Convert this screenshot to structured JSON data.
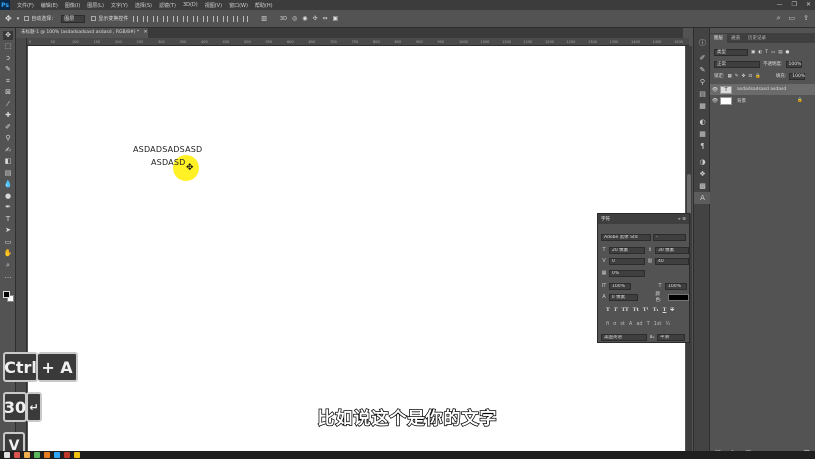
{
  "menubar": {
    "logo": "Ps",
    "items": [
      "文件(F)",
      "编辑(E)",
      "图像(I)",
      "图层(L)",
      "文字(Y)",
      "选择(S)",
      "滤镜(T)",
      "3D(D)",
      "视图(V)",
      "窗口(W)",
      "帮助(H)"
    ],
    "window_controls": [
      "—",
      "❐",
      "✕"
    ]
  },
  "options": {
    "auto_select_label": "自动选择：",
    "auto_select_value": "图层",
    "show_transform_label": "显示变换控件",
    "right_icons": [
      "⌕",
      "▭",
      "⇪"
    ]
  },
  "document": {
    "tab_title": "未标题-1 @ 100% (asdadsadsasd asdasd , RGB/8#) *",
    "ruler_ticks": [
      "0",
      "50",
      "100",
      "150",
      "200",
      "250",
      "300",
      "350",
      "400",
      "450",
      "500",
      "550",
      "600",
      "650",
      "700",
      "750",
      "800",
      "850",
      "900",
      "950",
      "1000",
      "1050",
      "1100",
      "1150",
      "1200",
      "1250",
      "1300",
      "1350",
      "1400",
      "1450",
      "1500"
    ],
    "text_line1": "ASDADSADSASD",
    "text_line2": "ASDASD"
  },
  "layers_panel": {
    "tabs": [
      "图层",
      "通道",
      "历史记录"
    ],
    "kind_label": "类型",
    "blend_mode": "正常",
    "opacity_label": "不透明度:",
    "opacity_value": "100%",
    "lock_label": "锁定:",
    "fill_label": "填充:",
    "fill_value": "100%",
    "layers": [
      {
        "name": "asdadsadsasd asdasd",
        "thumb": "T",
        "selected": true
      },
      {
        "name": "背景",
        "thumb": "",
        "selected": false
      }
    ]
  },
  "character_panel": {
    "title": "字符",
    "font_family": "Adobe 黑体 Std",
    "font_style": "-",
    "font_size": "20 像素",
    "leading": "30 像素",
    "kerning": "0",
    "tracking": "40",
    "tsume": "0%",
    "vertical_scale": "100%",
    "horizontal_scale": "100%",
    "baseline_shift": "0 像素",
    "color_label": "颜色:",
    "style_buttons": [
      "T",
      "T",
      "TT",
      "Tt",
      "T¹",
      "T₁",
      "T",
      "T"
    ],
    "ot_buttons": [
      "fi",
      "σ",
      "st",
      "A",
      "ad",
      "T",
      "1st",
      "½"
    ],
    "language": "美国英语",
    "aa_label": "aₐ",
    "antialias": "平滑"
  },
  "overlay": {
    "key_ctrl": "Ctrl",
    "plus_a": "+ A",
    "key_30": "30",
    "key_enter": "↵",
    "key_v": "V"
  },
  "subtitle": "比如说这个是你的文字"
}
